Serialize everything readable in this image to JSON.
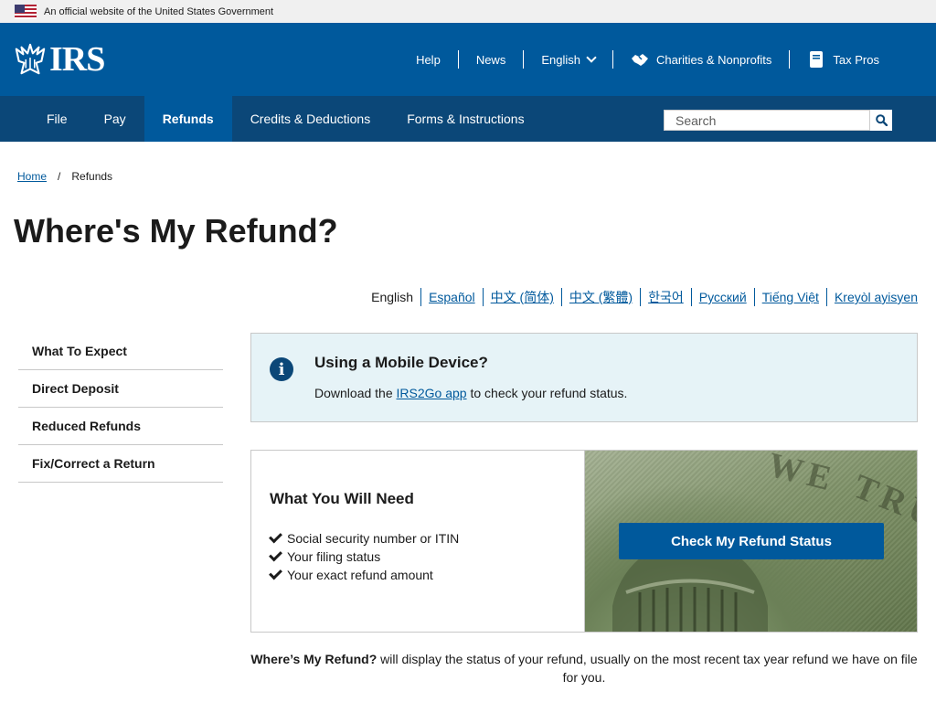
{
  "gov_banner": {
    "text": "An official website of the United States Government"
  },
  "header": {
    "logo_text": "IRS",
    "utility": [
      {
        "label": "Help"
      },
      {
        "label": "News"
      },
      {
        "label": "English"
      },
      {
        "label": "Charities & Nonprofits"
      },
      {
        "label": "Tax Pros"
      }
    ]
  },
  "nav": {
    "items": [
      {
        "label": "File"
      },
      {
        "label": "Pay"
      },
      {
        "label": "Refunds",
        "active": true
      },
      {
        "label": "Credits & Deductions"
      },
      {
        "label": "Forms & Instructions"
      }
    ],
    "search_placeholder": "Search"
  },
  "breadcrumb": {
    "home": "Home",
    "sep": "/",
    "current": "Refunds"
  },
  "page_title": "Where's My Refund?",
  "languages": [
    "English",
    "Español",
    "中文 (简体)",
    "中文 (繁體)",
    "한국어",
    "Русский",
    "Tiếng Việt",
    "Kreyòl ayisyen"
  ],
  "sidebar": {
    "items": [
      {
        "label": "What To Expect"
      },
      {
        "label": "Direct Deposit"
      },
      {
        "label": "Reduced Refunds"
      },
      {
        "label": "Fix/Correct a Return"
      }
    ]
  },
  "alert": {
    "title": "Using a Mobile Device?",
    "body_prefix": "Download the ",
    "link": "IRS2Go app",
    "body_suffix": " to check your refund status."
  },
  "card": {
    "title": "What You Will Need",
    "items": [
      "Social security number or ITIN",
      "Your filing status",
      "Your exact refund amount"
    ],
    "cta_label": "Check My Refund Status",
    "money_text_1": "WE",
    "money_text_2": "TRU"
  },
  "note": {
    "bold": "Where’s My Refund?",
    "text": " will display the status of your refund, usually on the most recent tax year refund we have on file for you."
  },
  "colors": {
    "primary": "#00599c",
    "nav_dark": "#0b4778",
    "alert_bg": "#e6f3f7"
  }
}
